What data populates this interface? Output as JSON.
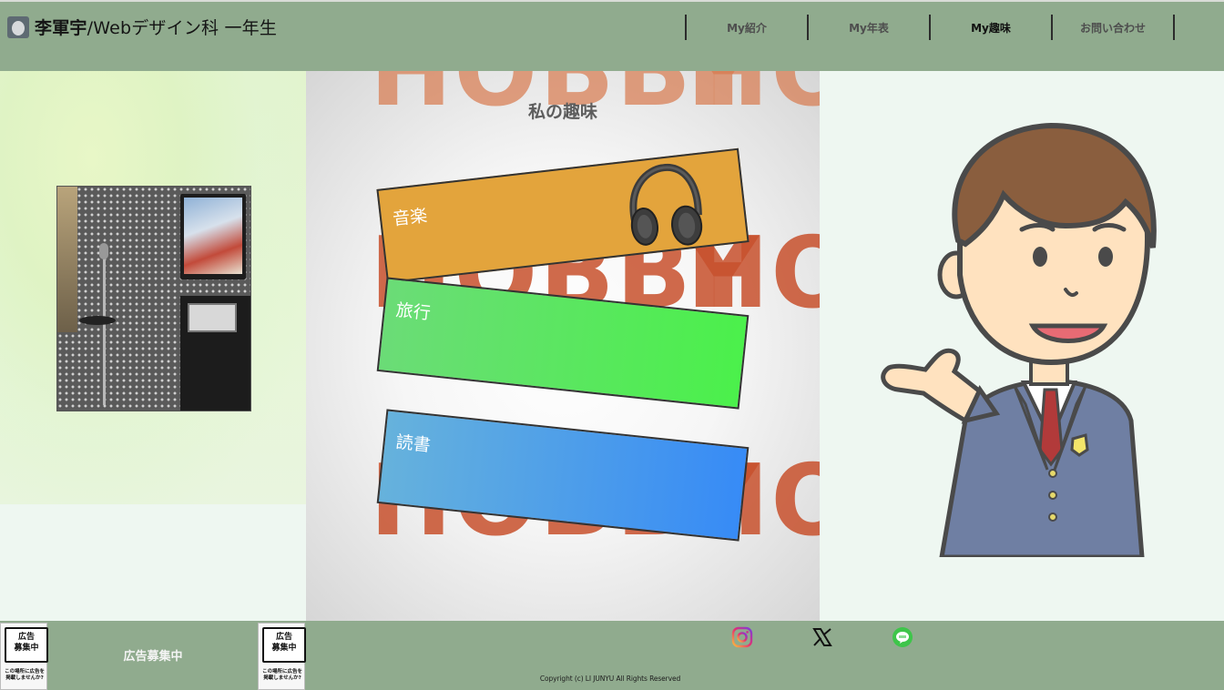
{
  "header": {
    "name": "李軍宇",
    "subtitle": "/Webデザイン科 一年生",
    "nav": [
      {
        "label": "My紹介",
        "active": false
      },
      {
        "label": "My年表",
        "active": false
      },
      {
        "label": "My趣味",
        "active": true
      },
      {
        "label": "お問い合わせ",
        "active": false
      }
    ]
  },
  "main": {
    "title": "私の趣味",
    "background_word": "HOBBY",
    "cards": [
      {
        "label": "音楽",
        "color": "#e3a43c",
        "icon": "headphones-icon"
      },
      {
        "label": "旅行",
        "color": "#4bf04b"
      },
      {
        "label": "読書",
        "color": "#378bf6"
      }
    ]
  },
  "footer": {
    "ad_sign": "広告\n募集中",
    "ad_small": "この場所に広告を\n掲載しませんか?",
    "ad_text": "広告募集中",
    "social": [
      "instagram-icon",
      "x-icon",
      "line-icon"
    ],
    "copyright": "Copyright (c) LI JUNYU All Rights Reserved"
  },
  "colors": {
    "header_bg": "#90ab8e",
    "page_bg": "#eef7f1"
  }
}
